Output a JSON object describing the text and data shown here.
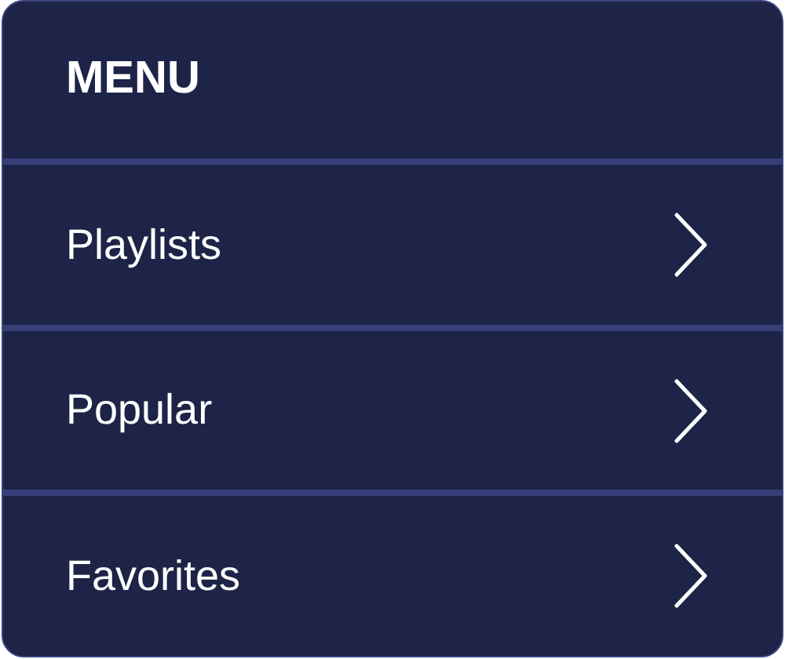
{
  "menu": {
    "title": "MENU",
    "items": [
      {
        "label": "Playlists"
      },
      {
        "label": "Popular"
      },
      {
        "label": "Favorites"
      }
    ]
  }
}
